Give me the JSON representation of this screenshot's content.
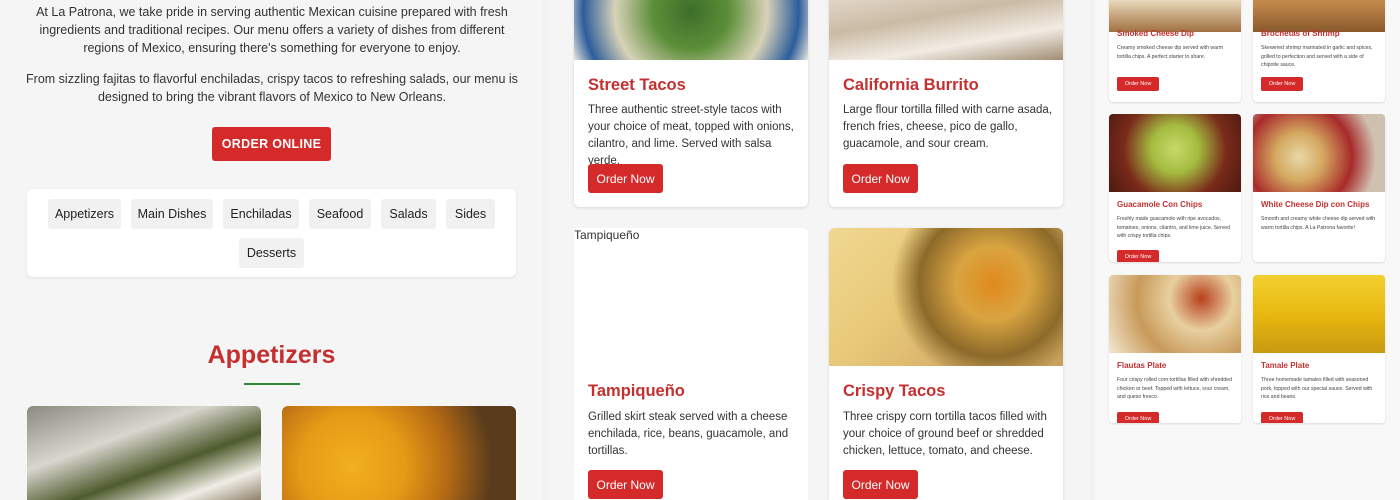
{
  "intro": {
    "paragraph1": "At La Patrona, we take pride in serving authentic Mexican cuisine prepared with fresh ingredients and traditional recipes. Our menu offers a variety of dishes from different regions of Mexico, ensuring there's something for everyone to enjoy.",
    "paragraph2": "From sizzling fajitas to flavorful enchiladas, crispy tacos to refreshing salads, our menu is designed to bring the vibrant flavors of Mexico to New Orleans."
  },
  "order_online_label": "ORDER ONLINE",
  "categories": [
    "Appetizers",
    "Main Dishes",
    "Enchiladas",
    "Seafood",
    "Salads",
    "Sides",
    "Desserts"
  ],
  "section_title": "Appetizers",
  "main_cards": [
    {
      "title": "Street Tacos",
      "description": "Three authentic street-style tacos with your choice of meat, topped with onions, cilantro, and lime. Served with salsa verde.",
      "button": "Order Now"
    },
    {
      "title": "California Burrito",
      "description": "Large flour tortilla filled with carne asada, french fries, cheese, pico de gallo, guacamole, and sour cream.",
      "button": "Order Now"
    },
    {
      "title": "Tampiqueño",
      "image_alt": "Tampiqueño",
      "description": "Grilled skirt steak served with a cheese enchilada, rice, beans, guacamole, and tortillas.",
      "button": "Order Now"
    },
    {
      "title": "Crispy Tacos",
      "description": "Three crispy corn tortilla tacos filled with your choice of ground beef or shredded chicken, lettuce, tomato, and cheese.",
      "button": "Order Now"
    }
  ],
  "mini_cards": [
    {
      "title": "Smoked Cheese Dip",
      "description": "Creamy smoked cheese dip served with warm tortilla chips. A perfect starter to share.",
      "button": "Order Now"
    },
    {
      "title": "Brochetas of Shrimp",
      "description": "Skewered shrimp marinated in garlic and spices, grilled to perfection and served with a side of chipotle sauce.",
      "button": "Order Now"
    },
    {
      "title": "Guacamole Con Chips",
      "description": "Freshly made guacamole with ripe avocados, tomatoes, onions, cilantro, and lime juice. Served with crispy tortilla chips.",
      "button": "Order Now"
    },
    {
      "title": "White Cheese Dip con Chips",
      "description": "Smooth and creamy white cheese dip served with warm tortilla chips. A La Patrona favorite!",
      "button": "Order Now"
    },
    {
      "title": "Flautas Plate",
      "description": "Four crispy rolled corn tortillas filled with shredded chicken or beef. Topped with lettuce, sour cream, and queso fresco.",
      "button": "Order Now"
    },
    {
      "title": "Tamale Plate",
      "description": "Three homemade tamales filled with seasoned pork, topped with our special sauce. Served with rice and beans.",
      "button": "Order Now"
    }
  ],
  "colors": {
    "accent_red": "#d42a2a",
    "title_red": "#c43030",
    "underline_green": "#2a8a3a"
  }
}
